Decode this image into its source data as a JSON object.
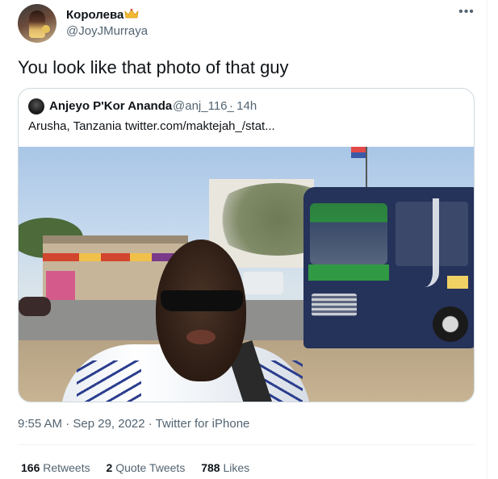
{
  "author": {
    "display_name": "Королева",
    "handle": "@JoyJMurraya",
    "crown_icon_color": "#f2b933"
  },
  "menu": {
    "more_label": "•••"
  },
  "tweet": {
    "text": "You look like that photo of that guy"
  },
  "quoted_tweet": {
    "display_name": "Anjeyo P'Kor Ananda",
    "handle": "@anj_116_",
    "separator": "·",
    "time": "14h",
    "text": "Arusha, Tanzania  twitter.com/maktejah_/stat...",
    "media_icon": "photo-icon"
  },
  "meta": {
    "timestamp": "9:55 AM · Sep 29, 2022 · Twitter for iPhone"
  },
  "stats": {
    "retweets_count": "166",
    "retweets_label": "Retweets",
    "quotes_count": "2",
    "quotes_label": "Quote Tweets",
    "likes_count": "788",
    "likes_label": "Likes"
  },
  "colors": {
    "text_primary": "#0f1419",
    "text_secondary": "#536471",
    "border": "#cfd9de",
    "divider": "#eff3f4"
  }
}
